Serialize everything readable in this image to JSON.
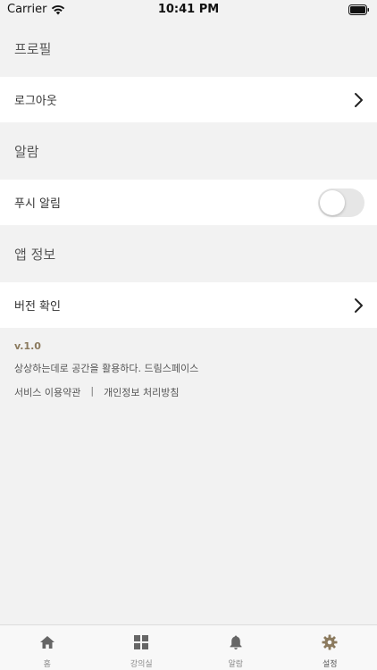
{
  "status_bar": {
    "carrier": "Carrier",
    "time": "10:41 PM"
  },
  "sections": {
    "profile": {
      "header": "프로필",
      "row_label": "로그아웃"
    },
    "alarm": {
      "header": "알람",
      "row_label": "푸시 알림",
      "toggle_on": false
    },
    "app_info": {
      "header": "앱 정보",
      "row_label": "버전 확인"
    }
  },
  "info": {
    "version": "v.1.0",
    "slogan": "상상하는데로 공간을 활용하다. 드림스페이스",
    "terms_link": "서비스 이용약관",
    "separator": "|",
    "privacy_link": "개인정보 처리방침"
  },
  "tab_bar": {
    "tabs": [
      {
        "label": "홈",
        "icon": "home-icon",
        "active": false
      },
      {
        "label": "강의실",
        "icon": "grid-icon",
        "active": false
      },
      {
        "label": "알람",
        "icon": "bell-icon",
        "active": false
      },
      {
        "label": "설정",
        "icon": "gear-icon",
        "active": true
      }
    ]
  },
  "colors": {
    "accent": "#8b7a5e",
    "icon_inactive": "#666666",
    "background": "#f2f2f2"
  }
}
